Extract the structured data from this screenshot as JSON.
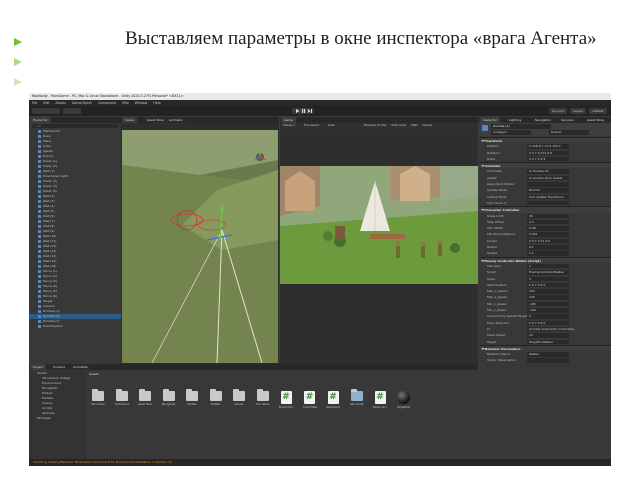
{
  "slide": {
    "title": "Выставляем параметры в окне инспектора «врага Агента»",
    "accent_color": "#6fbf3a"
  },
  "editor": {
    "window_title": "Rootbody - MainGame - PC, Mac & Linux Standalone - Unity 2020.3.27f1 Personal* <DX11>",
    "menu": [
      "File",
      "Edit",
      "Assets",
      "GameObject",
      "Component",
      "Mile",
      "Window",
      "Help"
    ],
    "toolbar": {
      "account": "Account",
      "layers": "Layers",
      "layout": "Default"
    },
    "hierarchy": {
      "tab": "Hierarchy",
      "search_placeholder": "All",
      "items": [
        "MainGame*",
        "Road",
        "Plane",
        "Cube",
        "Spawn",
        "Enemy",
        "Tower (1)",
        "Tower (2)",
        "Wall (1)",
        "Directional Light",
        "Tower (3)",
        "Tower (4)",
        "Tower (5)",
        "Wall (2)",
        "Wall (3)",
        "Wall (4)",
        "Wall (5)",
        "Wall (6)",
        "Wall (7)",
        "Wall (8)",
        "Wall (9)",
        "Wall (10)",
        "Wall (11)",
        "Wall (12)",
        "Wall (13)",
        "Wall (14)",
        "Wall (15)",
        "Wall (16)",
        "Fence (1)",
        "Fence (2)",
        "Fence (3)",
        "Fence (4)",
        "Fence (5)",
        "Fence (6)",
        "Target",
        "Camera",
        "Zombie (1)",
        "Zombie (2)",
        "Zombie (3)",
        "EventSystem"
      ],
      "selected_index": 37
    },
    "scene_tabs": [
      "Scene",
      "Asset Store",
      "Animator"
    ],
    "game_tabs": [
      "Game"
    ],
    "game_toolbar": {
      "display": "Display 1",
      "aspect": "Free Aspect",
      "scale": "Scale",
      "maximize": "Maximize On Play",
      "mute": "Mute Audio",
      "stats": "Stats",
      "gizmos": "Gizmos"
    },
    "inspector": {
      "tabs": [
        "Inspector",
        "Lighting",
        "Navigation",
        "Services",
        "Asset Store"
      ],
      "object_name": "Zombie (1)",
      "tag": "Untagged",
      "layer": "Default",
      "rows": [
        {
          "type": "head",
          "label": "Transform"
        },
        {
          "label": "Position",
          "value": "X 226.8   Y 13   Z 122.7"
        },
        {
          "label": "Rotation",
          "value": "X 0   Y 0.712   Z 0"
        },
        {
          "label": "Scale",
          "value": "X 2   Y 2   Z 2"
        },
        {
          "type": "head",
          "label": "Animator"
        },
        {
          "label": "Controller",
          "value": "ts Zombie 01"
        },
        {
          "label": "Avatar",
          "value": "ts zombie anim Avatar"
        },
        {
          "label": "Apply Root Motion",
          "value": ""
        },
        {
          "label": "Update Mode",
          "value": "Normal"
        },
        {
          "label": "Culling Mode",
          "value": "Cull Update Transforms"
        },
        {
          "label": "Clip Count: 0",
          "value": ""
        },
        {
          "type": "head",
          "label": "Character Controller"
        },
        {
          "label": "Slope Limit",
          "value": "45"
        },
        {
          "label": "Step Offset",
          "value": "0.3"
        },
        {
          "label": "Skin Width",
          "value": "0.08"
        },
        {
          "label": "Min Move Distance",
          "value": "0.001"
        },
        {
          "label": "Center",
          "value": "X 0   Y 0.27   Z 0"
        },
        {
          "label": "Radius",
          "value": "0.1"
        },
        {
          "label": "Height",
          "value": "1.5"
        },
        {
          "type": "head",
          "label": "Enemy Controller Walker (Script)"
        },
        {
          "label": "Max Skip",
          "value": "1"
        },
        {
          "label": "Script",
          "value": "EnemyControllerWalker"
        },
        {
          "label": "Scale",
          "value": "5"
        },
        {
          "label": "Start Position",
          "value": "X 0   Y 0   Z 0"
        },
        {
          "label": "Max_x_spawn",
          "value": "195"
        },
        {
          "label": "Max_z_spawn",
          "value": "195"
        },
        {
          "label": "Min_x_spawn",
          "value": "-195"
        },
        {
          "label": "Min_z_spawn",
          "value": "-195"
        },
        {
          "label": "Current Poly Update Target",
          "value": "0"
        },
        {
          "label": "Move Direction",
          "value": "X 0   Y 0   Z 0"
        },
        {
          "label": "Cc",
          "value": "Zombie (Character Controller)"
        },
        {
          "label": "Move Speed",
          "value": "10"
        },
        {
          "label": "Target",
          "value": "TargetForWalker"
        },
        {
          "type": "head",
          "label": "Behavior Parameters"
        },
        {
          "label": "Behavior Name",
          "value": "Walker"
        },
        {
          "label": "Vector Observation",
          "value": ""
        }
      ]
    },
    "project": {
      "tabs": [
        "Project",
        "Console",
        "Animation"
      ],
      "tree": [
        "Assets",
        "3D Cartoon Village",
        "Environment",
        "ML-Agents",
        "Models",
        "Prefabs",
        "Scenes",
        "Scripts",
        "Textures",
        "Packages"
      ],
      "breadcrumb": "Assets",
      "assets": [
        {
          "name": "3D Cartoon Vill...",
          "icon": "folder-icon"
        },
        {
          "name": "Animations",
          "icon": "folder-icon"
        },
        {
          "name": "Asset Store",
          "icon": "folder-icon"
        },
        {
          "name": "ML-Agents",
          "icon": "folder-icon"
        },
        {
          "name": "Models",
          "icon": "folder-icon"
        },
        {
          "name": "Prefabs",
          "icon": "folder-icon"
        },
        {
          "name": "Scenes",
          "icon": "folder-icon"
        },
        {
          "name": "Toon Skins",
          "icon": "folder-icon"
        },
        {
          "name": "EnemyContr...",
          "icon": "script-icon"
        },
        {
          "name": "EnemyWalk...",
          "icon": "script-icon"
        },
        {
          "name": "GameContro...",
          "icon": "script-icon"
        },
        {
          "name": "New Terrain",
          "icon": "terrain-icon"
        },
        {
          "name": "Player Scri...",
          "icon": "script-icon"
        },
        {
          "name": "TargetMat",
          "icon": "sphere-icon"
        }
      ]
    },
    "status_message": "Checking missing Behavior Parameters component for EnemyControllerWalker in Zombie (1)"
  }
}
